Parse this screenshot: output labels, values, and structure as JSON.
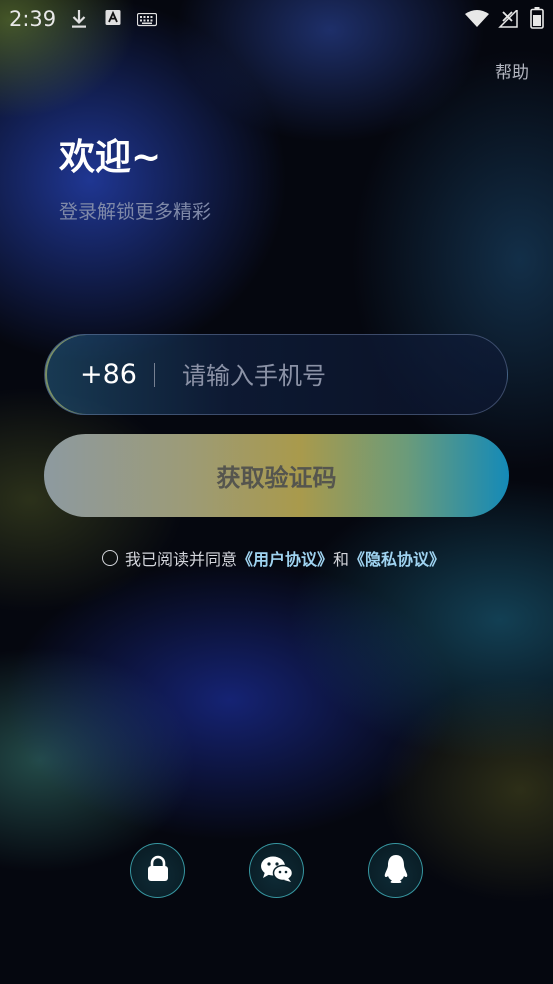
{
  "status_bar": {
    "time": "2:39",
    "icons": [
      "download-icon",
      "text-a-icon",
      "keyboard-icon",
      "wifi-icon",
      "signal-icon",
      "battery-icon"
    ]
  },
  "header": {
    "help_label": "帮助"
  },
  "welcome": {
    "title": "欢迎~",
    "subtitle": "登录解锁更多精彩"
  },
  "phone_field": {
    "country_code": "+86",
    "value": "",
    "placeholder": "请输入手机号"
  },
  "get_code_button": {
    "label": "获取验证码"
  },
  "agreement": {
    "prefix": "我已阅读并同意",
    "user_agreement": "《用户协议》",
    "conjunction": "和",
    "privacy_policy": "《隐私协议》",
    "checked": false
  },
  "social_login": {
    "items": [
      "lock-icon",
      "wechat-icon",
      "qq-icon"
    ]
  },
  "colors": {
    "link": "#9fd3f0",
    "social_border": "#46bec8",
    "button_gradient_end": "#148ab8"
  }
}
